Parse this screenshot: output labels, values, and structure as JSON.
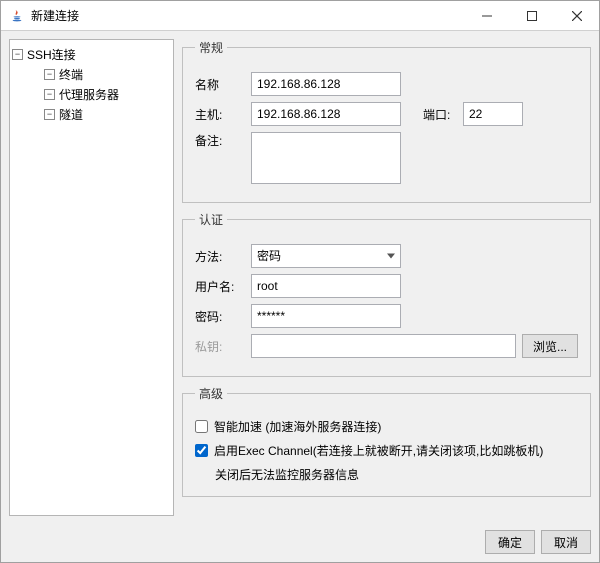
{
  "window": {
    "title": "新建连接"
  },
  "sidebar": {
    "root": {
      "label": "SSH连接"
    },
    "items": [
      {
        "label": "终端"
      },
      {
        "label": "代理服务器"
      },
      {
        "label": "隧道"
      }
    ]
  },
  "groups": {
    "general": {
      "legend": "常规",
      "name_label": "名称",
      "name_value": "192.168.86.128",
      "host_label": "主机:",
      "host_value": "192.168.86.128",
      "port_label": "端口:",
      "port_value": "22",
      "remark_label": "备注:",
      "remark_value": ""
    },
    "auth": {
      "legend": "认证",
      "method_label": "方法:",
      "method_value": "密码",
      "user_label": "用户名:",
      "user_value": "root",
      "password_label": "密码:",
      "password_value": "******",
      "privkey_label": "私钥:",
      "privkey_value": "",
      "browse_label": "浏览..."
    },
    "advanced": {
      "legend": "高级",
      "smart_accel_label": "智能加速 (加速海外服务器连接)",
      "smart_accel_checked": false,
      "exec_channel_label": "启用Exec Channel(若连接上就被断开,请关闭该项,比如跳板机)",
      "exec_channel_checked": true,
      "exec_channel_note": "关闭后无法监控服务器信息"
    }
  },
  "footer": {
    "ok": "确定",
    "cancel": "取消"
  }
}
